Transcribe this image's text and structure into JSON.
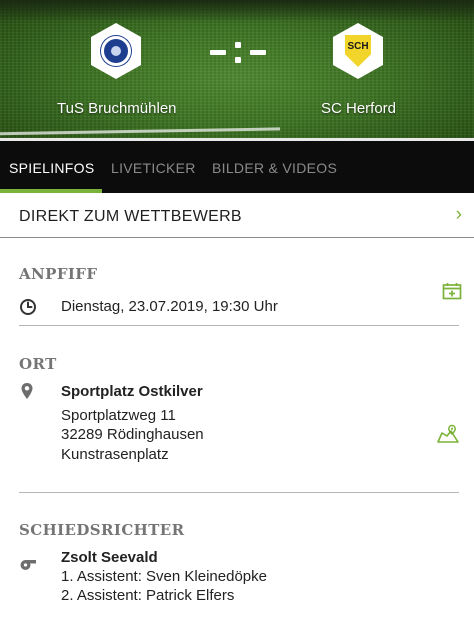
{
  "match": {
    "home_team": "TuS Bruchmühlen",
    "away_team": "SC Herford",
    "away_crest_text": "SCH"
  },
  "tabs": [
    {
      "label": "SPIELINFOS",
      "active": true
    },
    {
      "label": "LIVETICKER",
      "active": false
    },
    {
      "label": "BILDER & VIDEOS",
      "active": false
    }
  ],
  "direct_link": {
    "label": "DIREKT ZUM WETTBEWERB",
    "chevron": "›"
  },
  "kickoff": {
    "heading": "ANPFIFF",
    "datetime": "Dienstag, 23.07.2019, 19:30 Uhr",
    "icon": "clock-icon",
    "action_icon": "add-calendar-icon"
  },
  "venue": {
    "heading": "ORT",
    "name": "Sportplatz Ostkilver",
    "street": "Sportplatzweg 11",
    "city": "32289 Rödinghausen",
    "surface": "Kunstrasenplatz",
    "icon": "location-pin-icon",
    "action_icon": "map-icon"
  },
  "referees": {
    "heading": "SCHIEDSRICHTER",
    "main": "Zsolt Seevald",
    "assistant1": "1. Assistent: Sven Kleinedöpke",
    "assistant2": "2. Assistent: Patrick Elfers",
    "icon": "whistle-icon"
  },
  "colors": {
    "accent": "#7bb239",
    "tabbar": "#0c0c0c",
    "section_heading": "#757575"
  }
}
